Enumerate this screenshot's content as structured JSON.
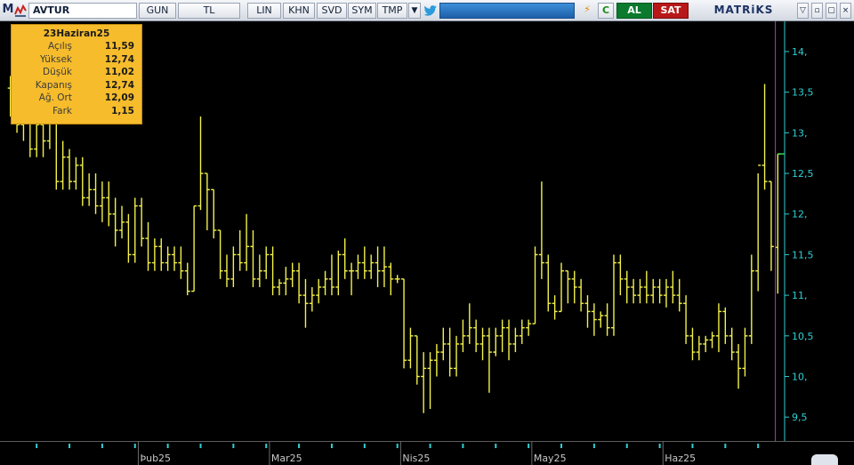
{
  "toolbar": {
    "logo_letter": "M",
    "symbol": "AVTUR",
    "period": "GUN",
    "currency": "TL",
    "buttons": [
      "LIN",
      "KHN",
      "SVD",
      "SYM",
      "TMP"
    ],
    "dropdown_glyph": "▼",
    "bolt_glyph": "⚡",
    "c_label": "C",
    "buy_label": "AL",
    "sell_label": "SAT",
    "brand": "MATRiKS",
    "window_controls": [
      "▽",
      "▫",
      "▢",
      "×"
    ],
    "icons": [
      "matriks-logo-icon",
      "twitter-icon",
      "bolt-icon",
      "chevron-down-icon"
    ]
  },
  "info_box": {
    "date": "23Haziran25",
    "rows": [
      {
        "label": "Açılış",
        "value": "11,59"
      },
      {
        "label": "Yüksek",
        "value": "12,74"
      },
      {
        "label": "Düşük",
        "value": "11,02"
      },
      {
        "label": "Kapanış",
        "value": "12,74"
      },
      {
        "label": "Ağ. Ort",
        "value": "12,09"
      },
      {
        "label": "Fark",
        "value": "1,15"
      }
    ]
  },
  "colors": {
    "background": "#000000",
    "bars": "#f2f24a",
    "axis": "#2fd0d4",
    "cursor_line": "#b03cbc",
    "info_bg": "#f6bc2c",
    "buy": "#0b7a2d",
    "sell": "#b81818"
  },
  "chart_data": {
    "type": "ohlc",
    "y_ticks": [
      "14,",
      "13,5",
      "13,",
      "12,5",
      "12,",
      "11,5",
      "11,",
      "10,5",
      "10,",
      "9,5"
    ],
    "y_tick_values": [
      14,
      13.5,
      13,
      12.5,
      12,
      11.5,
      11,
      10.5,
      10,
      9.5
    ],
    "ylim": [
      9.25,
      14.35
    ],
    "x_labels": [
      "Þub25",
      "Mar25",
      "Nis25",
      "May25",
      "Haz25"
    ],
    "x_label_index": [
      20,
      40,
      60,
      80,
      100
    ],
    "last_close_value": 12.74,
    "bars": [
      [
        13.55,
        13.7,
        13.2,
        13.4
      ],
      [
        13.4,
        13.6,
        13.0,
        13.1
      ],
      [
        13.1,
        13.4,
        12.9,
        13.2
      ],
      [
        13.2,
        13.3,
        12.7,
        12.8
      ],
      [
        12.8,
        13.3,
        12.7,
        13.1
      ],
      [
        13.1,
        13.25,
        12.7,
        12.9
      ],
      [
        12.9,
        13.3,
        12.8,
        13.2
      ],
      [
        13.2,
        13.3,
        12.3,
        12.4
      ],
      [
        12.4,
        12.9,
        12.3,
        12.7
      ],
      [
        12.7,
        12.8,
        12.3,
        12.4
      ],
      [
        12.4,
        12.7,
        12.3,
        12.6
      ],
      [
        12.6,
        12.7,
        12.1,
        12.2
      ],
      [
        12.2,
        12.5,
        12.1,
        12.3
      ],
      [
        12.3,
        12.5,
        12.0,
        12.1
      ],
      [
        12.1,
        12.4,
        11.9,
        12.2
      ],
      [
        12.2,
        12.4,
        11.85,
        12.0
      ],
      [
        12.0,
        12.2,
        11.6,
        11.8
      ],
      [
        11.8,
        12.1,
        11.7,
        11.9
      ],
      [
        11.9,
        12.0,
        11.4,
        11.5
      ],
      [
        11.5,
        12.2,
        11.4,
        12.1
      ],
      [
        12.1,
        12.2,
        11.6,
        11.7
      ],
      [
        11.7,
        11.9,
        11.3,
        11.4
      ],
      [
        11.4,
        11.7,
        11.3,
        11.6
      ],
      [
        11.6,
        11.7,
        11.3,
        11.4
      ],
      [
        11.4,
        11.6,
        11.3,
        11.5
      ],
      [
        11.5,
        11.6,
        11.3,
        11.4
      ],
      [
        11.4,
        11.6,
        11.2,
        11.3
      ],
      [
        11.3,
        11.4,
        11.0,
        11.05
      ],
      [
        11.05,
        12.1,
        11.05,
        12.1
      ],
      [
        12.1,
        13.2,
        12.05,
        12.5
      ],
      [
        12.5,
        12.5,
        11.8,
        12.3
      ],
      [
        12.3,
        12.3,
        11.7,
        11.8
      ],
      [
        11.8,
        11.8,
        11.2,
        11.3
      ],
      [
        11.3,
        11.5,
        11.1,
        11.2
      ],
      [
        11.2,
        11.6,
        11.1,
        11.5
      ],
      [
        11.5,
        11.8,
        11.3,
        11.4
      ],
      [
        11.4,
        12.0,
        11.3,
        11.6
      ],
      [
        11.6,
        11.8,
        11.1,
        11.2
      ],
      [
        11.2,
        11.5,
        11.1,
        11.3
      ],
      [
        11.3,
        11.6,
        11.2,
        11.5
      ],
      [
        11.5,
        11.6,
        11.0,
        11.1
      ],
      [
        11.1,
        11.2,
        11.0,
        11.15
      ],
      [
        11.15,
        11.35,
        11.0,
        11.2
      ],
      [
        11.2,
        11.4,
        11.1,
        11.3
      ],
      [
        11.3,
        11.4,
        10.9,
        11.0
      ],
      [
        11.0,
        11.2,
        10.6,
        10.9
      ],
      [
        10.9,
        11.1,
        10.8,
        11.0
      ],
      [
        11.0,
        11.2,
        10.9,
        11.1
      ],
      [
        11.1,
        11.3,
        11.0,
        11.2
      ],
      [
        11.2,
        11.5,
        11.0,
        11.1
      ],
      [
        11.1,
        11.55,
        11.0,
        11.5
      ],
      [
        11.5,
        11.7,
        11.2,
        11.3
      ],
      [
        11.3,
        11.4,
        11.0,
        11.3
      ],
      [
        11.3,
        11.5,
        11.2,
        11.4
      ],
      [
        11.4,
        11.6,
        11.2,
        11.3
      ],
      [
        11.3,
        11.5,
        11.2,
        11.4
      ],
      [
        11.4,
        11.6,
        11.1,
        11.3
      ],
      [
        11.3,
        11.6,
        11.1,
        11.35
      ],
      [
        11.35,
        11.4,
        11.0,
        11.2
      ],
      [
        11.2,
        11.25,
        11.15,
        11.2
      ],
      [
        11.2,
        11.2,
        10.1,
        10.2
      ],
      [
        10.2,
        10.6,
        10.1,
        10.5
      ],
      [
        10.5,
        10.5,
        9.9,
        10.0
      ],
      [
        10.0,
        10.3,
        9.55,
        10.1
      ],
      [
        10.1,
        10.3,
        9.6,
        10.2
      ],
      [
        10.2,
        10.4,
        10.0,
        10.3
      ],
      [
        10.3,
        10.6,
        10.2,
        10.4
      ],
      [
        10.4,
        10.6,
        10.0,
        10.1
      ],
      [
        10.1,
        10.5,
        10.0,
        10.4
      ],
      [
        10.4,
        10.7,
        10.3,
        10.5
      ],
      [
        10.5,
        10.9,
        10.4,
        10.6
      ],
      [
        10.6,
        10.7,
        10.3,
        10.4
      ],
      [
        10.4,
        10.6,
        10.2,
        10.5
      ],
      [
        10.5,
        10.6,
        9.8,
        10.3
      ],
      [
        10.3,
        10.6,
        10.25,
        10.5
      ],
      [
        10.5,
        10.7,
        10.3,
        10.6
      ],
      [
        10.6,
        10.7,
        10.2,
        10.4
      ],
      [
        10.4,
        10.6,
        10.3,
        10.5
      ],
      [
        10.5,
        10.7,
        10.4,
        10.6
      ],
      [
        10.6,
        10.7,
        10.5,
        10.65
      ],
      [
        10.65,
        11.6,
        10.65,
        11.5
      ],
      [
        11.5,
        12.4,
        11.2,
        11.4
      ],
      [
        11.4,
        11.5,
        10.8,
        10.9
      ],
      [
        10.9,
        11.0,
        10.7,
        10.8
      ],
      [
        10.8,
        11.4,
        10.8,
        11.3
      ],
      [
        11.3,
        11.3,
        10.9,
        11.2
      ],
      [
        11.2,
        11.3,
        10.9,
        11.1
      ],
      [
        11.1,
        11.2,
        10.8,
        10.9
      ],
      [
        10.9,
        11.0,
        10.6,
        10.8
      ],
      [
        10.8,
        10.9,
        10.5,
        10.7
      ],
      [
        10.7,
        10.8,
        10.6,
        10.75
      ],
      [
        10.75,
        10.9,
        10.5,
        10.6
      ],
      [
        10.6,
        11.5,
        10.5,
        11.4
      ],
      [
        11.4,
        11.5,
        11.0,
        11.2
      ],
      [
        11.2,
        11.3,
        10.9,
        11.1
      ],
      [
        11.1,
        11.2,
        10.9,
        11.0
      ],
      [
        11.0,
        11.2,
        10.9,
        11.1
      ],
      [
        11.1,
        11.3,
        10.9,
        11.0
      ],
      [
        11.0,
        11.2,
        10.9,
        11.1
      ],
      [
        11.1,
        11.2,
        10.9,
        11.0
      ],
      [
        11.0,
        11.2,
        10.85,
        11.1
      ],
      [
        11.1,
        11.3,
        10.9,
        11.0
      ],
      [
        11.0,
        11.2,
        10.8,
        10.9
      ],
      [
        10.9,
        11.0,
        10.4,
        10.5
      ],
      [
        10.5,
        10.6,
        10.2,
        10.3
      ],
      [
        10.3,
        10.5,
        10.2,
        10.4
      ],
      [
        10.4,
        10.5,
        10.3,
        10.45
      ],
      [
        10.45,
        10.55,
        10.35,
        10.5
      ],
      [
        10.5,
        10.9,
        10.3,
        10.8
      ],
      [
        10.8,
        10.85,
        10.4,
        10.5
      ],
      [
        10.5,
        10.6,
        10.2,
        10.3
      ],
      [
        10.3,
        10.4,
        9.85,
        10.1
      ],
      [
        10.1,
        10.6,
        10.0,
        10.5
      ],
      [
        10.5,
        11.5,
        10.4,
        11.3
      ],
      [
        11.3,
        12.5,
        11.05,
        12.6
      ],
      [
        12.6,
        13.6,
        12.3,
        12.4
      ],
      [
        12.4,
        12.4,
        11.3,
        11.6
      ],
      [
        11.59,
        12.74,
        11.02,
        12.74
      ]
    ]
  }
}
